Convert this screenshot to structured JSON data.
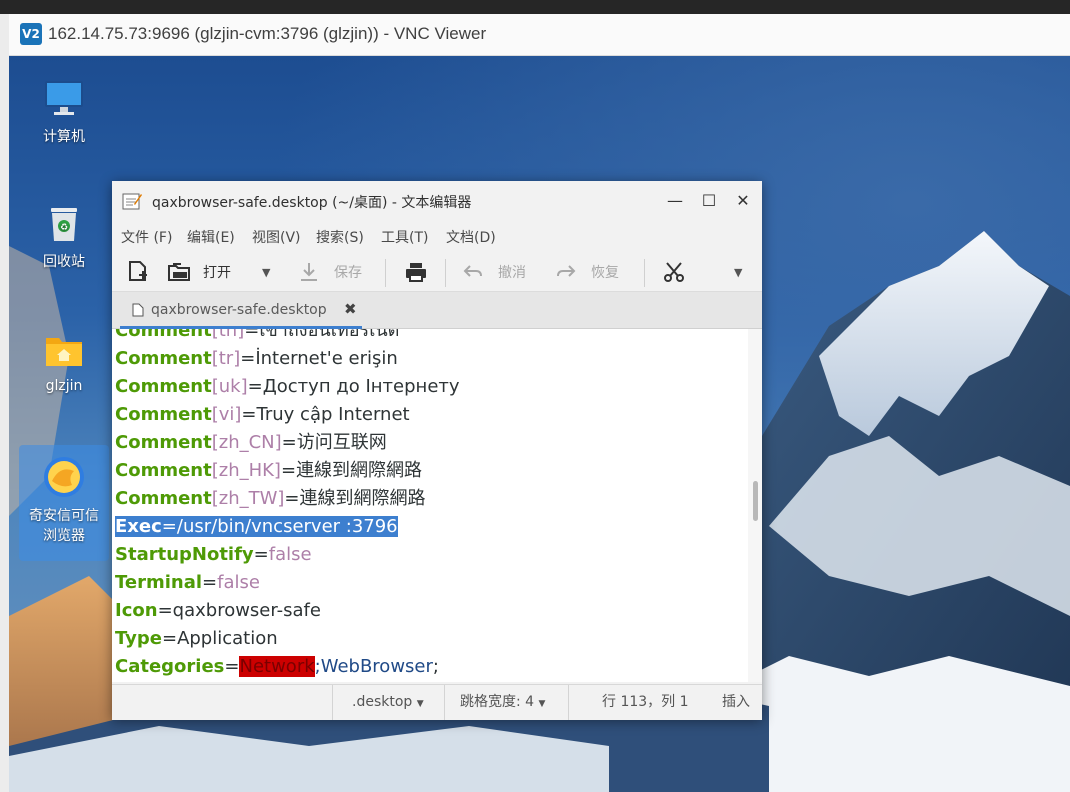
{
  "vnc": {
    "logo": "V2",
    "title": "162.14.75.73:9696 (glzjin-cvm:3796 (glzjin)) - VNC Viewer"
  },
  "desktop": {
    "icons": [
      {
        "label": "计算机",
        "icon": "computer-icon"
      },
      {
        "label": "回收站",
        "icon": "trash-icon"
      },
      {
        "label": "glzjin",
        "icon": "home-folder-icon"
      },
      {
        "label_line1": "奇安信可信",
        "label_line2": "浏览器",
        "icon": "browser-icon"
      }
    ]
  },
  "editor": {
    "title": "qaxbrowser-safe.desktop (~/桌面) - 文本编辑器",
    "menu": [
      "文件 (F)",
      "编辑(E)",
      "视图(V)",
      "搜索(S)",
      "工具(T)",
      "文档(D)"
    ],
    "toolbar": {
      "open": "打开",
      "save": "保存",
      "undo": "撤消",
      "redo": "恢复"
    },
    "tab": {
      "name": "qaxbrowser-safe.desktop",
      "close": "✖"
    },
    "lines": [
      {
        "key": "Comment",
        "bracket": "[th]",
        "eq": "=",
        "val": "เข้าถึงอินเทอร์เน็ต"
      },
      {
        "key": "Comment",
        "bracket": "[tr]",
        "eq": "=",
        "val": "İnternet'e erişin"
      },
      {
        "key": "Comment",
        "bracket": "[uk]",
        "eq": "=",
        "val": "Доступ до Інтернету"
      },
      {
        "key": "Comment",
        "bracket": "[vi]",
        "eq": "=",
        "val": "Truy cập Internet"
      },
      {
        "key": "Comment",
        "bracket": "[zh_CN]",
        "eq": "=",
        "val": "访问互联网"
      },
      {
        "key": "Comment",
        "bracket": "[zh_HK]",
        "eq": "=",
        "val": "連線到網際網路"
      },
      {
        "key": "Comment",
        "bracket": "[zh_TW]",
        "eq": "=",
        "val": "連線到網際網路"
      },
      {
        "key": "Exec",
        "eq": "=",
        "val": "/usr/bin/vncserver :3796"
      },
      {
        "key": "StartupNotify",
        "eq": "=",
        "val": "false"
      },
      {
        "key": "Terminal",
        "eq": "=",
        "val": "false"
      },
      {
        "key": "Icon",
        "eq": "=",
        "val": "qaxbrowser-safe"
      },
      {
        "key": "Type",
        "eq": "=",
        "val": "Application"
      },
      {
        "key": "Categories",
        "eq": "=",
        "val_err": "Network",
        "val_rest": ";WebBrowser",
        "val_tail": ";"
      }
    ],
    "status": {
      "lang": ".desktop",
      "tab_width": "跳格宽度: 4",
      "position": "行 113，列 1",
      "mode": "插入"
    }
  }
}
